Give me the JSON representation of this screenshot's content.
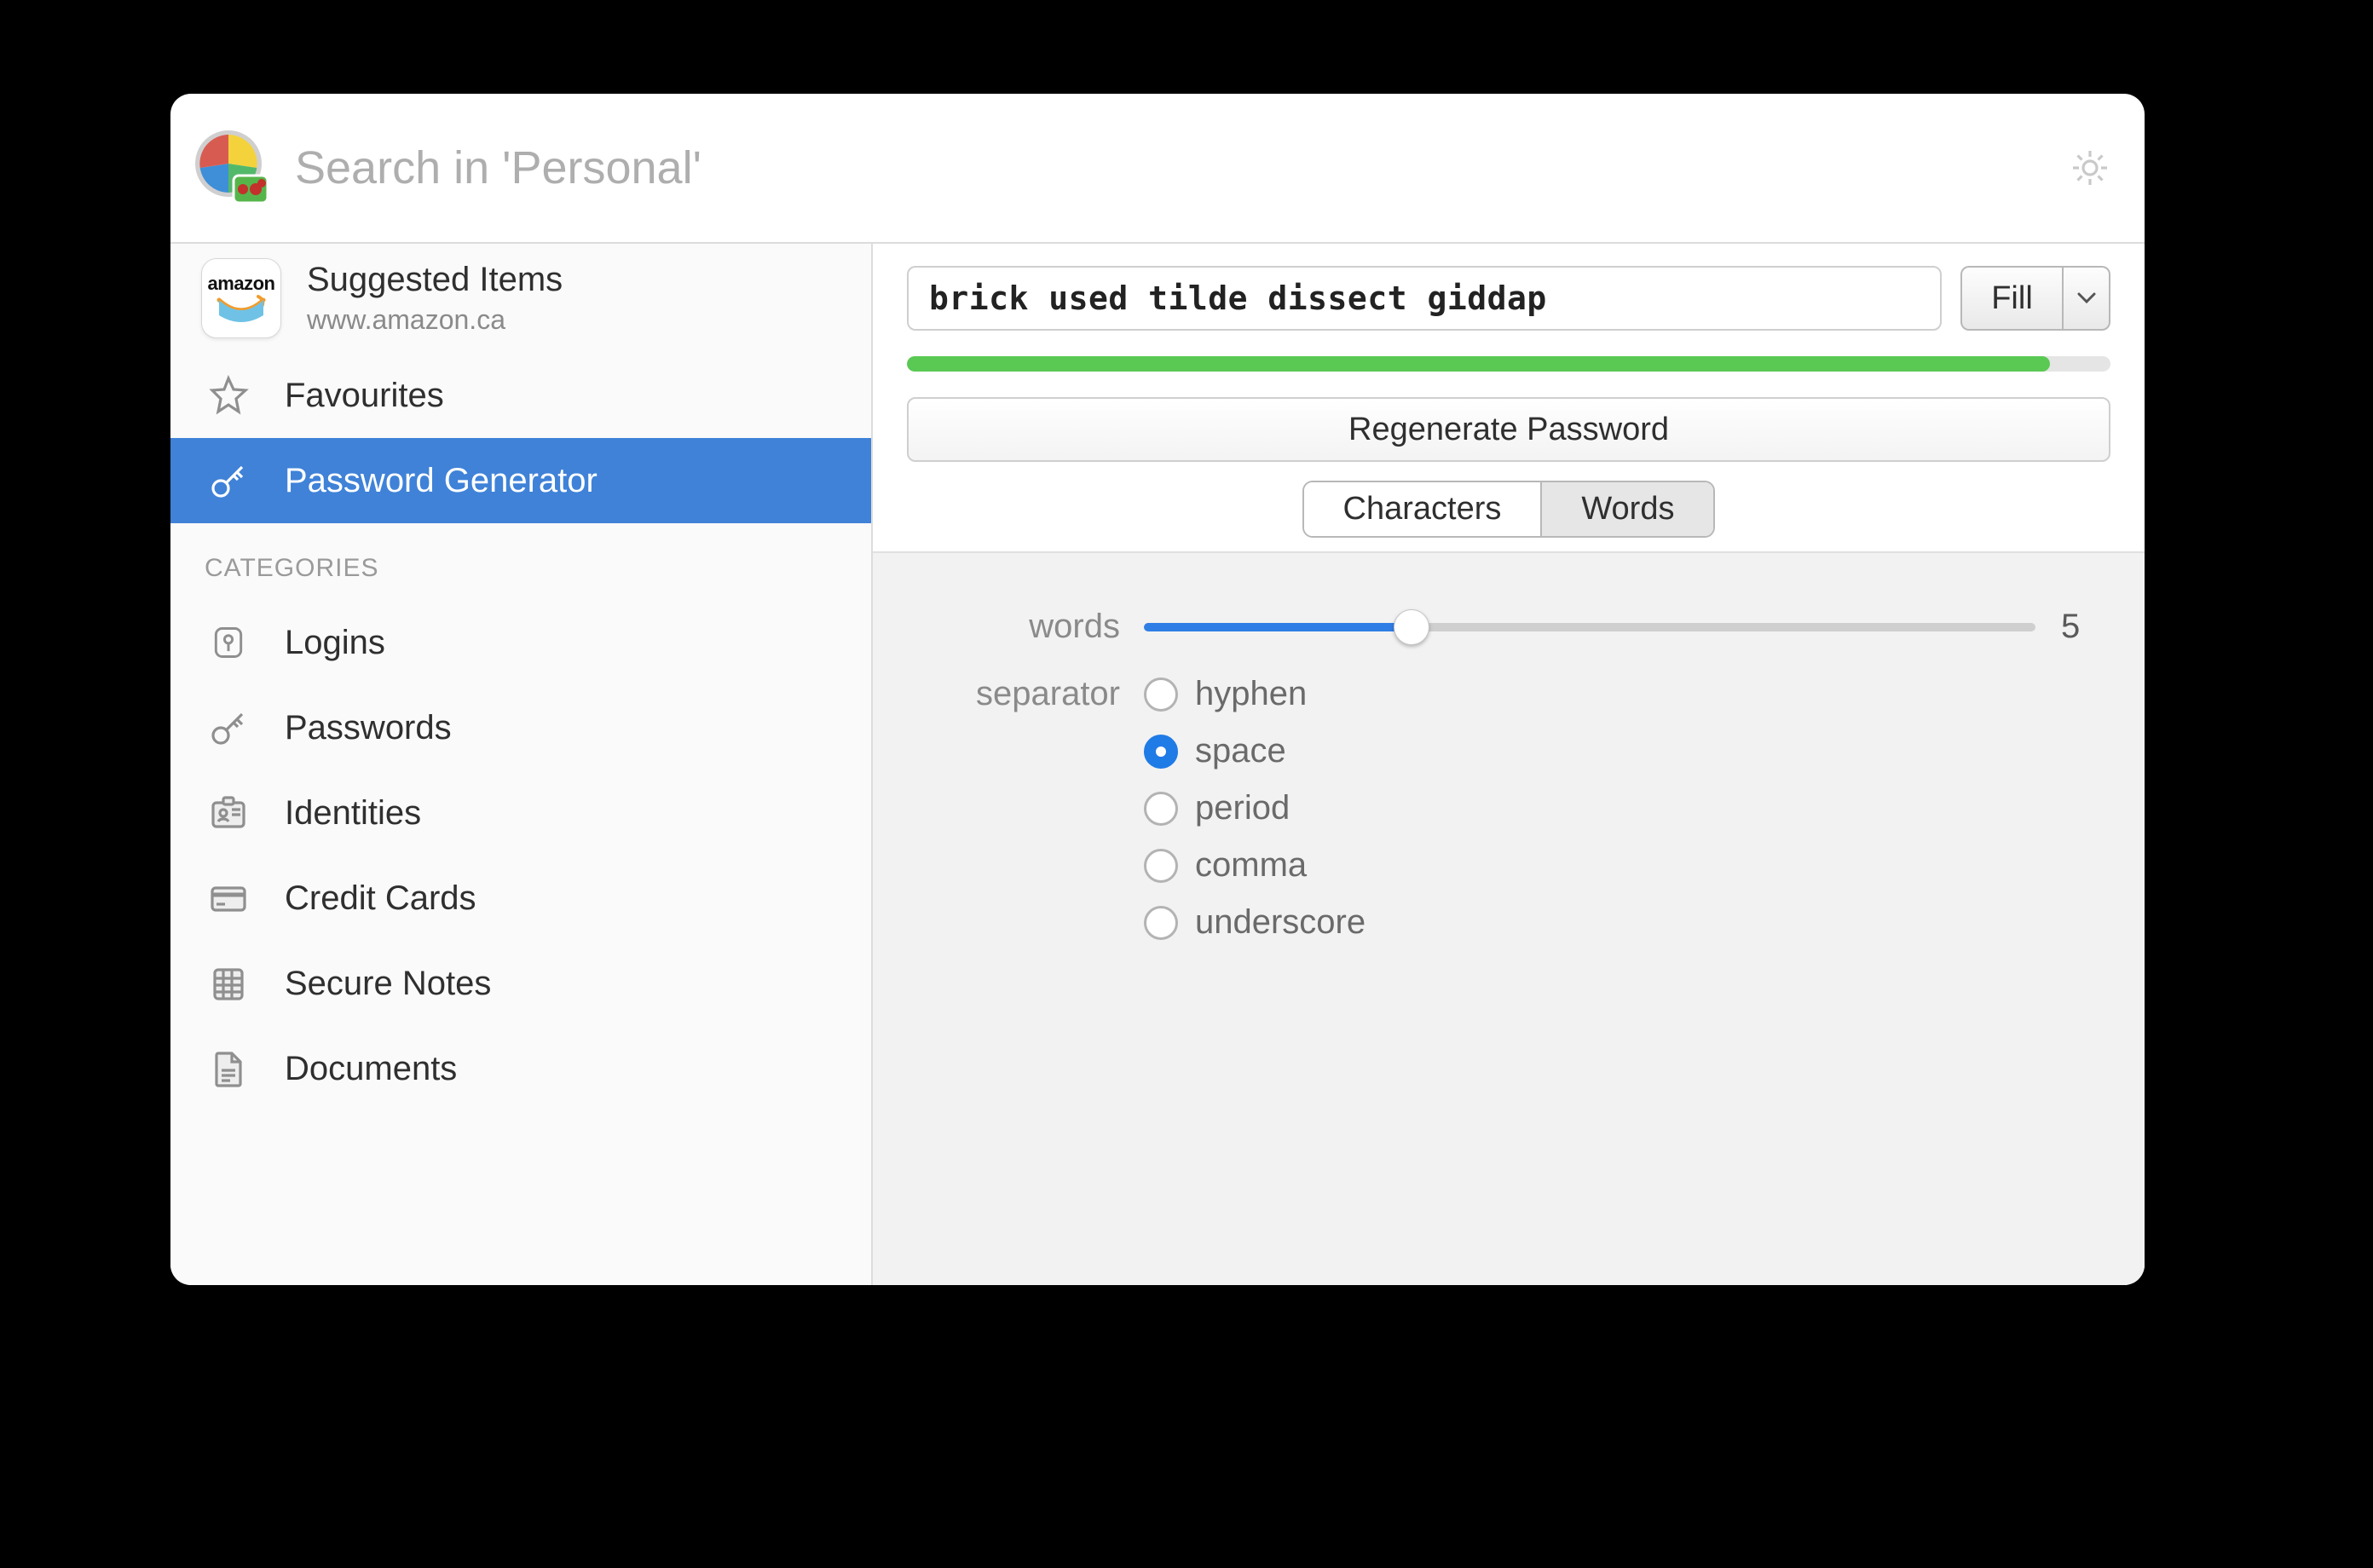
{
  "toolbar": {
    "search_placeholder": "Search in 'Personal'"
  },
  "sidebar": {
    "suggested": {
      "title": "Suggested Items",
      "subtitle": "www.amazon.ca",
      "thumb_label": "amazon"
    },
    "favourites_label": "Favourites",
    "generator_label": "Password Generator",
    "categories_header": "CATEGORIES",
    "categories": [
      {
        "label": "Logins",
        "icon": "keyhole"
      },
      {
        "label": "Passwords",
        "icon": "key"
      },
      {
        "label": "Identities",
        "icon": "id-card"
      },
      {
        "label": "Credit Cards",
        "icon": "credit-card"
      },
      {
        "label": "Secure Notes",
        "icon": "notes"
      },
      {
        "label": "Documents",
        "icon": "document"
      }
    ]
  },
  "generator": {
    "password": "brick used tilde dissect giddap",
    "fill_label": "Fill",
    "strength_percent": 95,
    "regenerate_label": "Regenerate Password",
    "tabs": {
      "characters": "Characters",
      "words": "Words",
      "active": "words"
    },
    "words": {
      "label": "words",
      "value": 5,
      "slider_percent": 30
    },
    "separator": {
      "label": "separator",
      "selected": "space",
      "options": [
        {
          "id": "hyphen",
          "label": "hyphen"
        },
        {
          "id": "space",
          "label": "space"
        },
        {
          "id": "period",
          "label": "period"
        },
        {
          "id": "comma",
          "label": "comma"
        },
        {
          "id": "underscore",
          "label": "underscore"
        }
      ]
    }
  }
}
